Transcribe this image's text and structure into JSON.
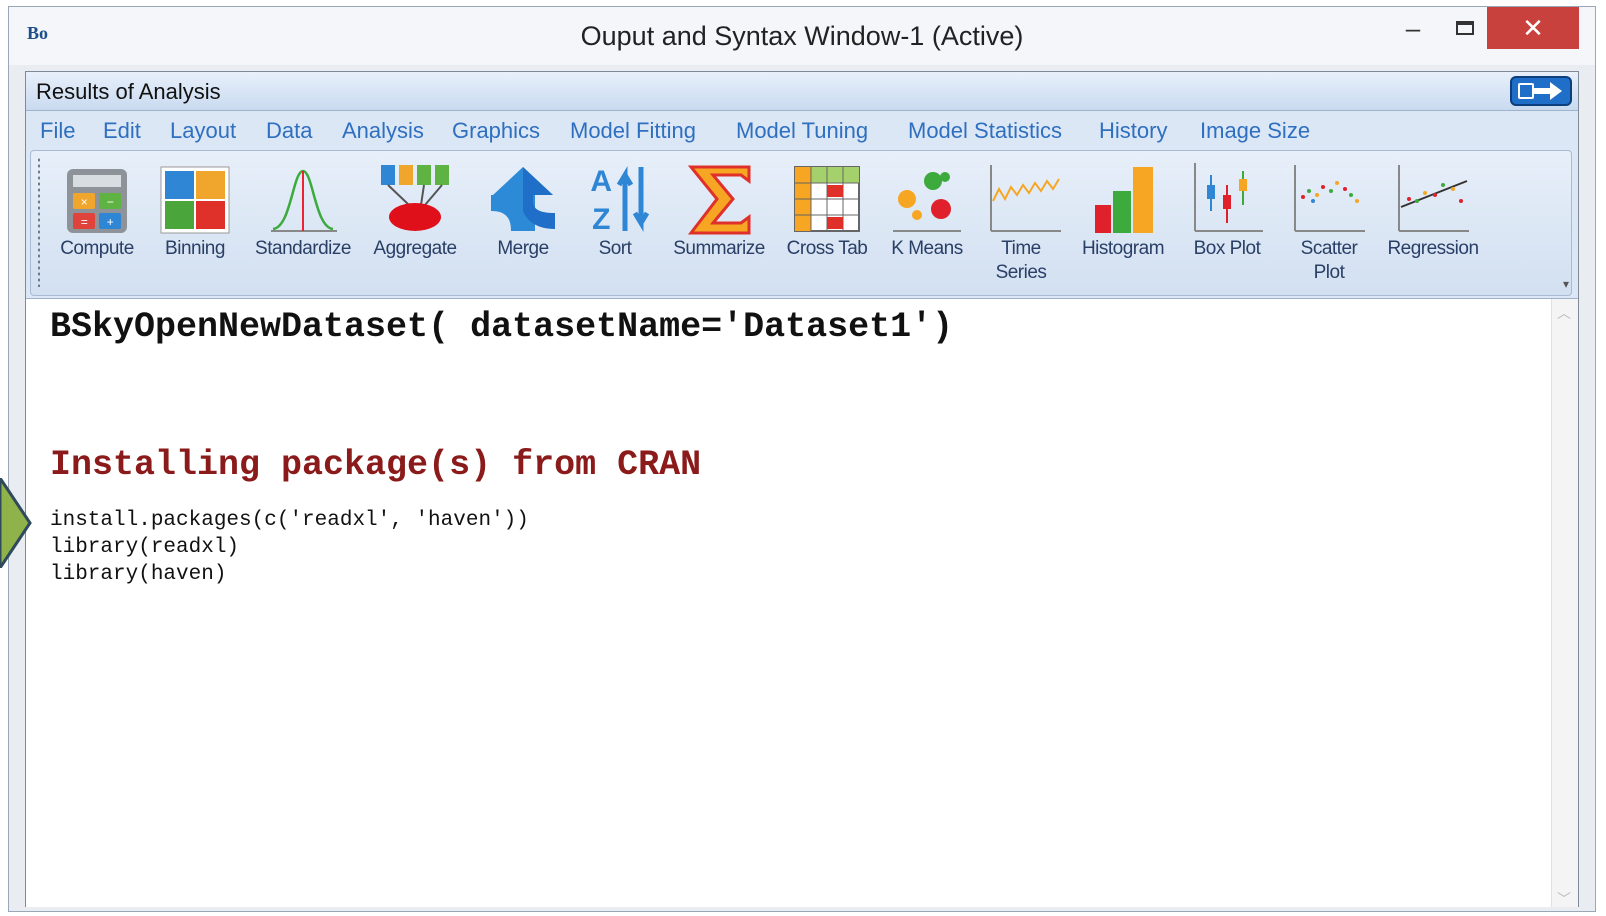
{
  "window": {
    "app_icon": "Bo",
    "title": "Ouput and Syntax Window-1 (Active)",
    "controls": {
      "minimize": "–",
      "close": "✕"
    }
  },
  "panel": {
    "header": "Results of Analysis",
    "menu": [
      "File",
      "Edit",
      "Layout",
      "Data",
      "Analysis",
      "Graphics",
      "Model Fitting",
      "Model Tuning",
      "Model Statistics",
      "History",
      "Image Size"
    ],
    "toolbar": [
      {
        "label": "Compute",
        "icon": "calculator-icon"
      },
      {
        "label": "Binning",
        "icon": "binning-icon"
      },
      {
        "label": "Standardize",
        "icon": "bell-curve-icon"
      },
      {
        "label": "Aggregate",
        "icon": "aggregate-icon"
      },
      {
        "label": "Merge",
        "icon": "merge-icon"
      },
      {
        "label": "Sort",
        "icon": "sort-az-icon"
      },
      {
        "label": "Summarize",
        "icon": "sigma-icon"
      },
      {
        "label": "Cross Tab",
        "icon": "cross-tab-icon"
      },
      {
        "label": "K Means",
        "icon": "k-means-icon"
      },
      {
        "label": "Time Series",
        "icon": "time-series-icon"
      },
      {
        "label": "Histogram",
        "icon": "histogram-icon"
      },
      {
        "label": "Box Plot",
        "icon": "box-plot-icon"
      },
      {
        "label": "Scatter Plot",
        "icon": "scatter-plot-icon"
      },
      {
        "label": "Regression",
        "icon": "regression-icon"
      }
    ]
  },
  "output": {
    "command": "BSkyOpenNewDataset( datasetName='Dataset1')",
    "section_title": "Installing package(s) from CRAN",
    "code_lines": [
      "install.packages(c('readxl', 'haven'))",
      "library(readxl)",
      "library(haven)"
    ]
  },
  "colors": {
    "menu_text": "#2e6fc0",
    "section_title": "#8b1a1a",
    "close_button": "#c9413c",
    "pointer_arrow": "#8fb24a"
  }
}
